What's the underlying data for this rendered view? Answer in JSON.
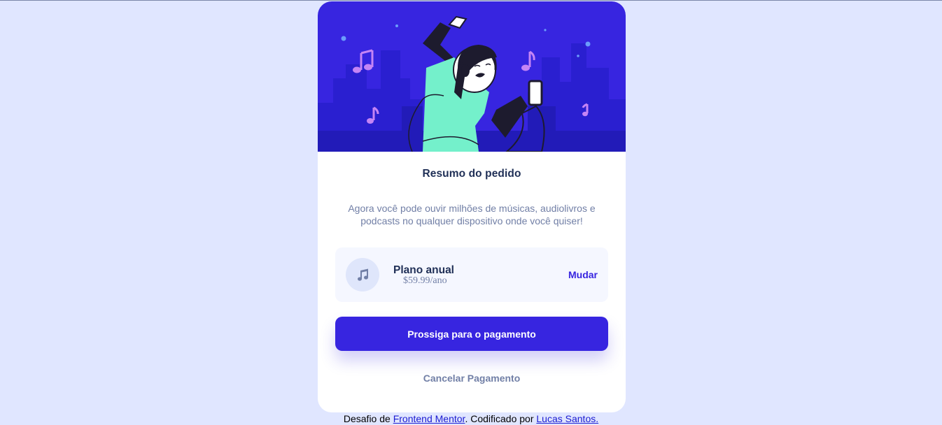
{
  "card": {
    "title": "Resumo do pedido",
    "description": "Agora você pode ouvir milhões de músicas, audiolivros e podcasts no qualquer dispositivo onde você quiser!",
    "plan": {
      "icon": "music-note-icon",
      "name": "Plano anual",
      "price": "$59.99/ano",
      "change_label": "Mudar"
    },
    "pay_label": "Prossiga para o pagamento",
    "cancel_label": "Cancelar Pagamento"
  },
  "footer": {
    "prefix": "Desafio de ",
    "link1": "Frontend Mentor",
    "middle": ". Codificado por ",
    "link2": "Lucas Santos."
  },
  "colors": {
    "page_bg": "#e0e6ff",
    "brand": "#3725e0",
    "dark_text": "#1f2f56",
    "muted_text": "#717fa6"
  }
}
